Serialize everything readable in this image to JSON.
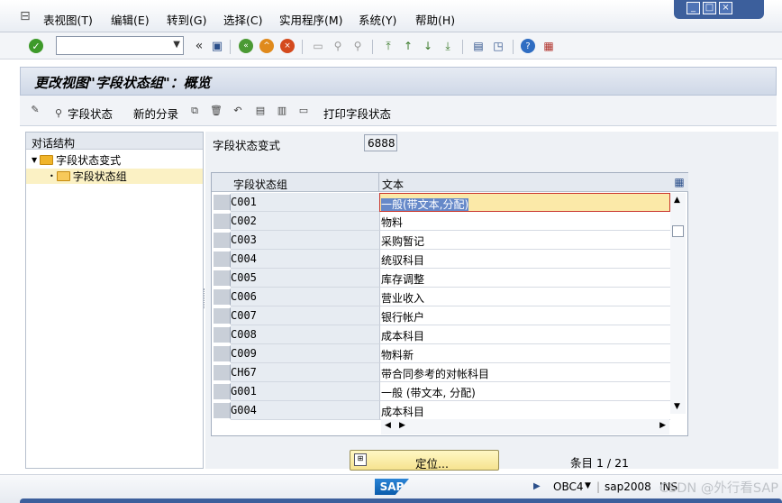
{
  "menu": {
    "items": [
      "表视图(T)",
      "编辑(E)",
      "转到(G)",
      "选择(C)",
      "实用程序(M)",
      "系统(Y)",
      "帮助(H)"
    ]
  },
  "window_controls": {
    "minimize": "_",
    "maximize": "□",
    "close": "×"
  },
  "toolbar": {
    "command_field_value": "",
    "icons": [
      "enter-check-icon",
      "back-icon",
      "exit-icon",
      "cancel-icon",
      "print-icon",
      "find-icon",
      "find-next-icon",
      "first-page-icon",
      "previous-page-icon",
      "next-page-icon",
      "last-page-icon",
      "new-session-icon",
      "shortcut-icon",
      "help-icon",
      "customize-layout-icon"
    ],
    "nav_arrows": "«"
  },
  "screen": {
    "title": "更改视图\"字段状态组\"：概览"
  },
  "app_toolbar": {
    "field_status": "字段状态",
    "new_entries": "新的分录",
    "print_field_status": "打印字段状态"
  },
  "dialog_structure": {
    "header": "对话结构",
    "root": "字段状态变式",
    "child": "字段状态组"
  },
  "variant": {
    "label": "字段状态变式",
    "value": "6888"
  },
  "table": {
    "columns": [
      "字段状态组",
      "文本"
    ],
    "rows": [
      {
        "key": "C001",
        "text": "一般(带文本,分配)"
      },
      {
        "key": "C002",
        "text": "物料"
      },
      {
        "key": "C003",
        "text": "采购暂记"
      },
      {
        "key": "C004",
        "text": "统驭科目"
      },
      {
        "key": "C005",
        "text": "库存调整"
      },
      {
        "key": "C006",
        "text": "营业收入"
      },
      {
        "key": "C007",
        "text": "银行帐户"
      },
      {
        "key": "C008",
        "text": "成本科目"
      },
      {
        "key": "C009",
        "text": "物料新"
      },
      {
        "key": "CH67",
        "text": "带合同参考的对帐科目"
      },
      {
        "key": "G001",
        "text": "一般 (带文本, 分配)"
      },
      {
        "key": "G004",
        "text": "成本科目"
      }
    ],
    "active_row": 0
  },
  "footer": {
    "position_button": "定位...",
    "entry_counter": "条目 1 / 21"
  },
  "status": {
    "logo": "SAP",
    "system": "OBC4",
    "server": "sap2008",
    "mode": "INS",
    "watermark": "CSDN @外行看SAP"
  }
}
